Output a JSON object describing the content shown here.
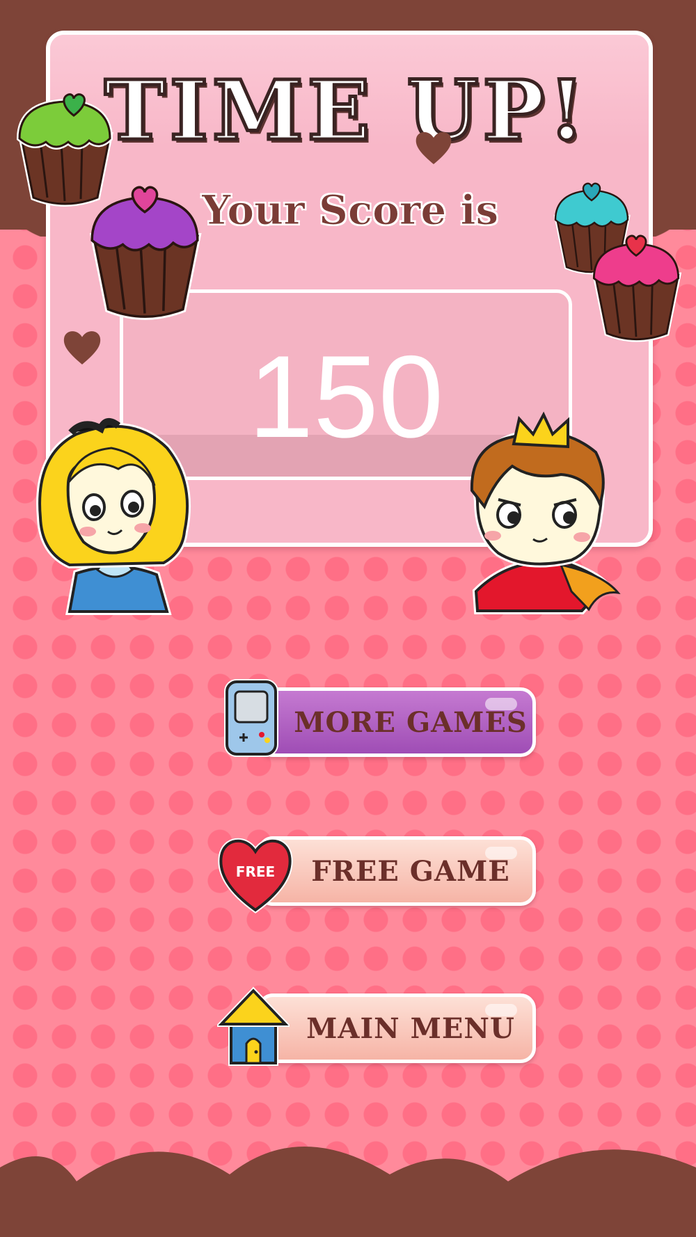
{
  "title": "TIME UP!",
  "subtitle": "Your Score is",
  "score": "150",
  "buttons": {
    "more_games": "MORE GAMES",
    "free_game": "FREE GAME",
    "main_menu": "MAIN MENU"
  },
  "icons": {
    "more_games": "handheld-console-icon",
    "free_game": "heart-icon",
    "free_game_badge": "FREE",
    "main_menu": "house-icon"
  },
  "colors": {
    "background": "#ff8a9b",
    "chocolate": "#7e4438",
    "panel": "#f8b7c8",
    "more_games_button": "#b160c5",
    "text_brown": "#6b2f2a"
  }
}
